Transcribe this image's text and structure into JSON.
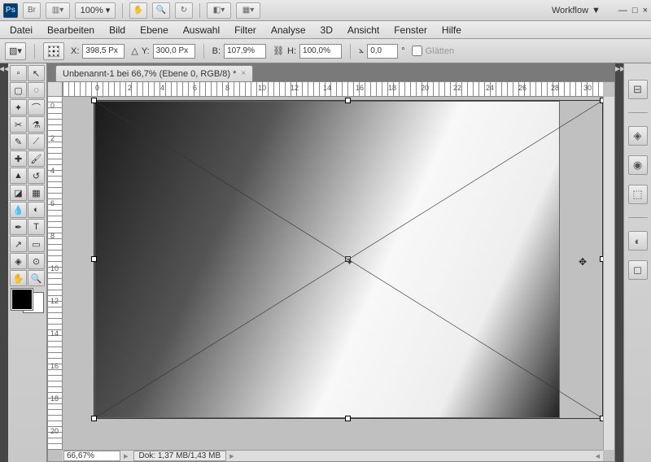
{
  "titlebar": {
    "br": "Br",
    "zoom": "100%",
    "workflow_label": "Workflow",
    "workflow_arrow": "▼"
  },
  "menu": {
    "items": [
      "Datei",
      "Bearbeiten",
      "Bild",
      "Ebene",
      "Auswahl",
      "Filter",
      "Analyse",
      "3D",
      "Ansicht",
      "Fenster",
      "Hilfe"
    ]
  },
  "options": {
    "x_label": "X:",
    "x_val": "398,5 Px",
    "y_label": "Y:",
    "y_val": "300,0 Px",
    "w_label": "B:",
    "w_val": "107,9%",
    "h_label": "H:",
    "h_val": "100,0%",
    "angle_val": "0,0",
    "angle_unit": "°",
    "glaetten": "Glätten"
  },
  "document": {
    "tab": "Unbenannt-1 bei 66,7% (Ebene 0, RGB/8) *",
    "zoom": "66,67%",
    "dok": "Dok: 1,37 MB/1,43 MB"
  },
  "ruler_h": [
    "0",
    "2",
    "4",
    "6",
    "8",
    "10",
    "12",
    "14",
    "16",
    "18",
    "20",
    "22",
    "24",
    "26",
    "28",
    "30"
  ],
  "ruler_v": [
    "0",
    "2",
    "4",
    "6",
    "8",
    "10",
    "12",
    "14",
    "16",
    "18",
    "20"
  ]
}
